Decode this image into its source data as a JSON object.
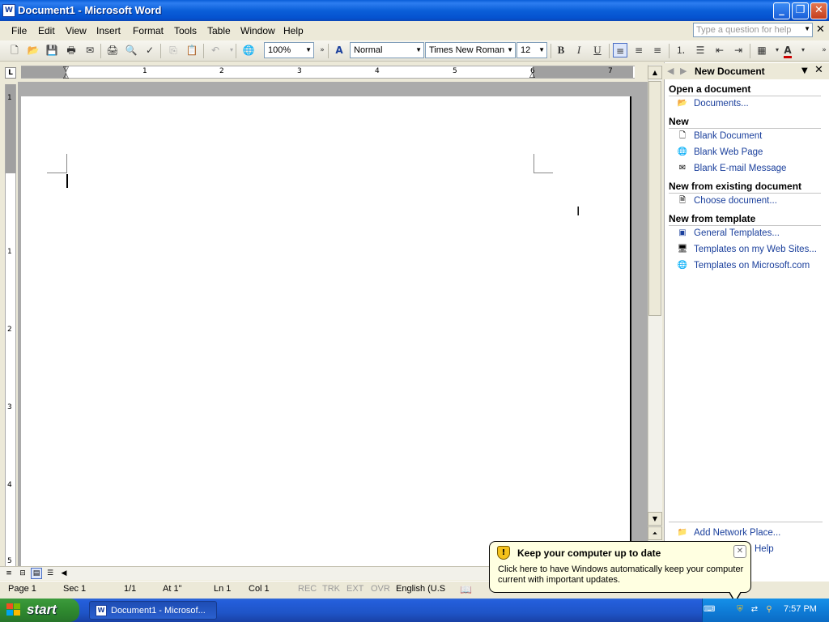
{
  "window": {
    "title": "Document1 - Microsoft Word",
    "app_icon": "word-doc-icon"
  },
  "menu": {
    "items": [
      "File",
      "Edit",
      "View",
      "Insert",
      "Format",
      "Tools",
      "Table",
      "Window",
      "Help"
    ],
    "help_placeholder": "Type a question for help"
  },
  "toolbar": {
    "zoom": "100%",
    "style": "Normal",
    "font": "Times New Roman",
    "font_size": "12",
    "bold": "B",
    "italic": "I",
    "underline": "U",
    "font_color": "#cc0000"
  },
  "ruler": {
    "h_numbers": [
      "1",
      "2",
      "3",
      "4",
      "5",
      "6",
      "7"
    ],
    "v_numbers": [
      "1",
      "1",
      "2",
      "3",
      "4",
      "5"
    ]
  },
  "taskpane": {
    "title": "New Document",
    "sections": [
      {
        "heading": "Open a document",
        "links": [
          {
            "icon": "folder-open-icon",
            "label": "Documents..."
          }
        ]
      },
      {
        "heading": "New",
        "links": [
          {
            "icon": "blank-document-icon",
            "label": "Blank Document"
          },
          {
            "icon": "web-page-icon",
            "label": "Blank Web Page"
          },
          {
            "icon": "email-icon",
            "label": "Blank E-mail Message"
          }
        ]
      },
      {
        "heading": "New from existing document",
        "links": [
          {
            "icon": "document-icon",
            "label": "Choose document..."
          }
        ]
      },
      {
        "heading": "New from template",
        "links": [
          {
            "icon": "template-icon",
            "label": "General Templates..."
          },
          {
            "icon": "web-templates-icon",
            "label": "Templates on my Web Sites..."
          },
          {
            "icon": "globe-icon",
            "label": "Templates on Microsoft.com"
          }
        ]
      }
    ],
    "footer_links": [
      {
        "icon": "network-place-icon",
        "label": "Add Network Place..."
      },
      {
        "icon": "help-icon",
        "label": "Help"
      }
    ]
  },
  "statusbar": {
    "page": "Page 1",
    "sec": "Sec 1",
    "pages": "1/1",
    "at": "At 1\"",
    "ln": "Ln 1",
    "col": "Col 1",
    "rec": "REC",
    "trk": "TRK",
    "ext": "EXT",
    "ovr": "OVR",
    "language": "English (U.S"
  },
  "balloon": {
    "title": "Keep your computer up to date",
    "text": "Click here to have Windows automatically keep your computer current with important updates."
  },
  "taskbar": {
    "start_label": "start",
    "task_label": "Document1 - Microsof...",
    "clock": "7:57 PM"
  }
}
